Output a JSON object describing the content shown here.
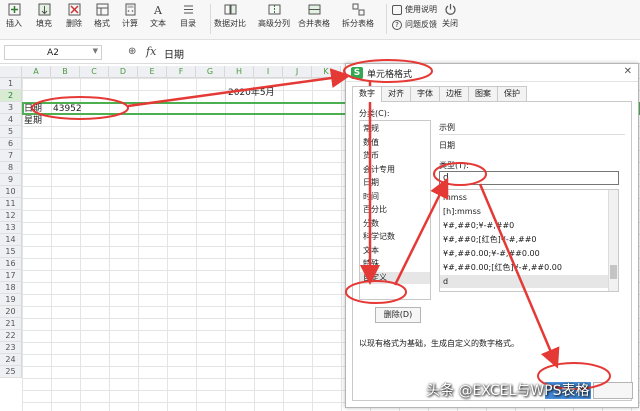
{
  "ribbon": {
    "insert": "插入",
    "fill": "填充",
    "delete": "删除",
    "format": "格式",
    "calc": "计算",
    "text": "文本",
    "toc": "目录",
    "data_compare": "数据对比",
    "advanced_split": "高级分列",
    "merge_tables": "合并表格",
    "split_tables": "拆分表格",
    "help": "使用说明",
    "feedback": "问题反馈",
    "close": "关闭"
  },
  "formula_bar": {
    "name_box": "A2",
    "fx": "fx",
    "value": "日期"
  },
  "columns": [
    "A",
    "B",
    "C",
    "D",
    "E",
    "F",
    "G",
    "H",
    "I",
    "J",
    "K"
  ],
  "rows": [
    "1",
    "2",
    "3",
    "4",
    "5",
    "6",
    "7",
    "8",
    "9",
    "10",
    "11",
    "12",
    "13",
    "14",
    "15",
    "16",
    "17",
    "18",
    "19",
    "20",
    "21",
    "22",
    "23",
    "24",
    "25"
  ],
  "cells": {
    "title": "2020年5月",
    "a2": "日期",
    "b2": "43952",
    "a3": "星期"
  },
  "dialog": {
    "title": "单元格格式",
    "tabs": [
      "数字",
      "对齐",
      "字体",
      "边框",
      "图案",
      "保护"
    ],
    "category_label": "分类(C):",
    "categories": [
      "常规",
      "数值",
      "货币",
      "会计专用",
      "日期",
      "时间",
      "百分比",
      "分数",
      "科学记数",
      "文本",
      "特殊",
      "自定义"
    ],
    "sample_label": "示例",
    "sample_value": "日期",
    "type_label": "类型(T):",
    "type_value": "d",
    "formats": [
      "mmss",
      "[h]:mmss",
      "¥#,##0;¥-#,##0",
      "¥#,##0;[红色]¥-#,##0",
      "¥#,##0.00;¥-#,##0.00",
      "¥#,##0.00;[红色]¥-#,##0.00",
      "d"
    ],
    "delete_button": "删除(D)",
    "note": "以现有格式为基础，生成自定义的数字格式。"
  },
  "watermark": "头条 @EXCEL与WPS表格",
  "colors": {
    "accent_green": "#4caf50",
    "annotation_red": "#e53935",
    "ok_blue": "#3f87d8"
  }
}
